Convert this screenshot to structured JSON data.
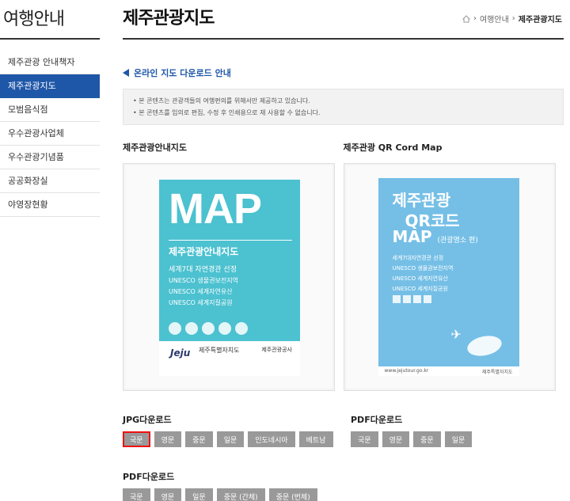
{
  "sidebar": {
    "title": "여행안내",
    "items": [
      {
        "label": "제주관광 안내책자",
        "active": false
      },
      {
        "label": "제주관광지도",
        "active": true
      },
      {
        "label": "모범음식점",
        "active": false
      },
      {
        "label": "우수관광사업체",
        "active": false
      },
      {
        "label": "우수관광기념품",
        "active": false
      },
      {
        "label": "공공화장실",
        "active": false
      },
      {
        "label": "야영장현황",
        "active": false
      }
    ]
  },
  "header": {
    "title": "제주관광지도",
    "breadcrumb": [
      "여행안내",
      "제주관광지도"
    ],
    "icons": {
      "home": "home-icon",
      "separator": "chevron-right-icon"
    }
  },
  "notice": {
    "heading": "온라인 지도 다운로드 안내",
    "lines": [
      "본 콘텐츠는 관광객들의 여행편의를 위해서만 제공하고 있습니다.",
      "본 콘텐츠를 임의로 편집, 수정 후 인쇄용으로 재 사용할 수 없습니다."
    ],
    "bullet": "•"
  },
  "cards": [
    {
      "label": "제주관광안내지도",
      "cover": {
        "big": "MAP",
        "subtitle": "제주관광안내지도",
        "lines": [
          "세계7대 자연경관 선정",
          "UNESCO 생물권보전지역",
          "UNESCO 세계자연유산",
          "UNESCO 세계지질공원"
        ],
        "footer_logo": "Jeju",
        "footer_gov": "제주특별자치도",
        "footer_org": "제주관광공사",
        "color": "#4cc1d0"
      }
    },
    {
      "label": "제주관광 QR Cord Map",
      "cover": {
        "line1": "제주관광",
        "line2": "QR코드",
        "line3": "MAP",
        "line3_small": "(관광명소 편)",
        "lines": [
          "세계7대자연경관 선정",
          "UNESCO 생물권보전지역",
          "UNESCO 세계자연유산",
          "UNESCO 세계지질공원"
        ],
        "footer_url": "www.jejutour.go.kr",
        "footer_org": "제주특별자치도",
        "color": "#75bfe6"
      }
    }
  ],
  "downloads": {
    "jpg_label": "JPG다운로드",
    "jpg_buttons": [
      {
        "label": "국문",
        "selected": true
      },
      {
        "label": "영문",
        "selected": false
      },
      {
        "label": "중문",
        "selected": false
      },
      {
        "label": "일문",
        "selected": false
      },
      {
        "label": "인도네시아",
        "selected": false
      },
      {
        "label": "베트남",
        "selected": false
      }
    ],
    "pdf_label": "PDF다운로드",
    "pdf_buttons": [
      {
        "label": "국문"
      },
      {
        "label": "영문"
      },
      {
        "label": "일문"
      },
      {
        "label": "중문 (간체)"
      },
      {
        "label": "중문 (번체)"
      }
    ],
    "qr_pdf_label": "PDF다운로드",
    "qr_pdf_buttons": [
      {
        "label": "국문"
      },
      {
        "label": "영문"
      },
      {
        "label": "중문"
      },
      {
        "label": "일문"
      }
    ]
  },
  "colors": {
    "accent": "#1f57a8",
    "button": "#999999",
    "selected_border": "#ee1111"
  }
}
